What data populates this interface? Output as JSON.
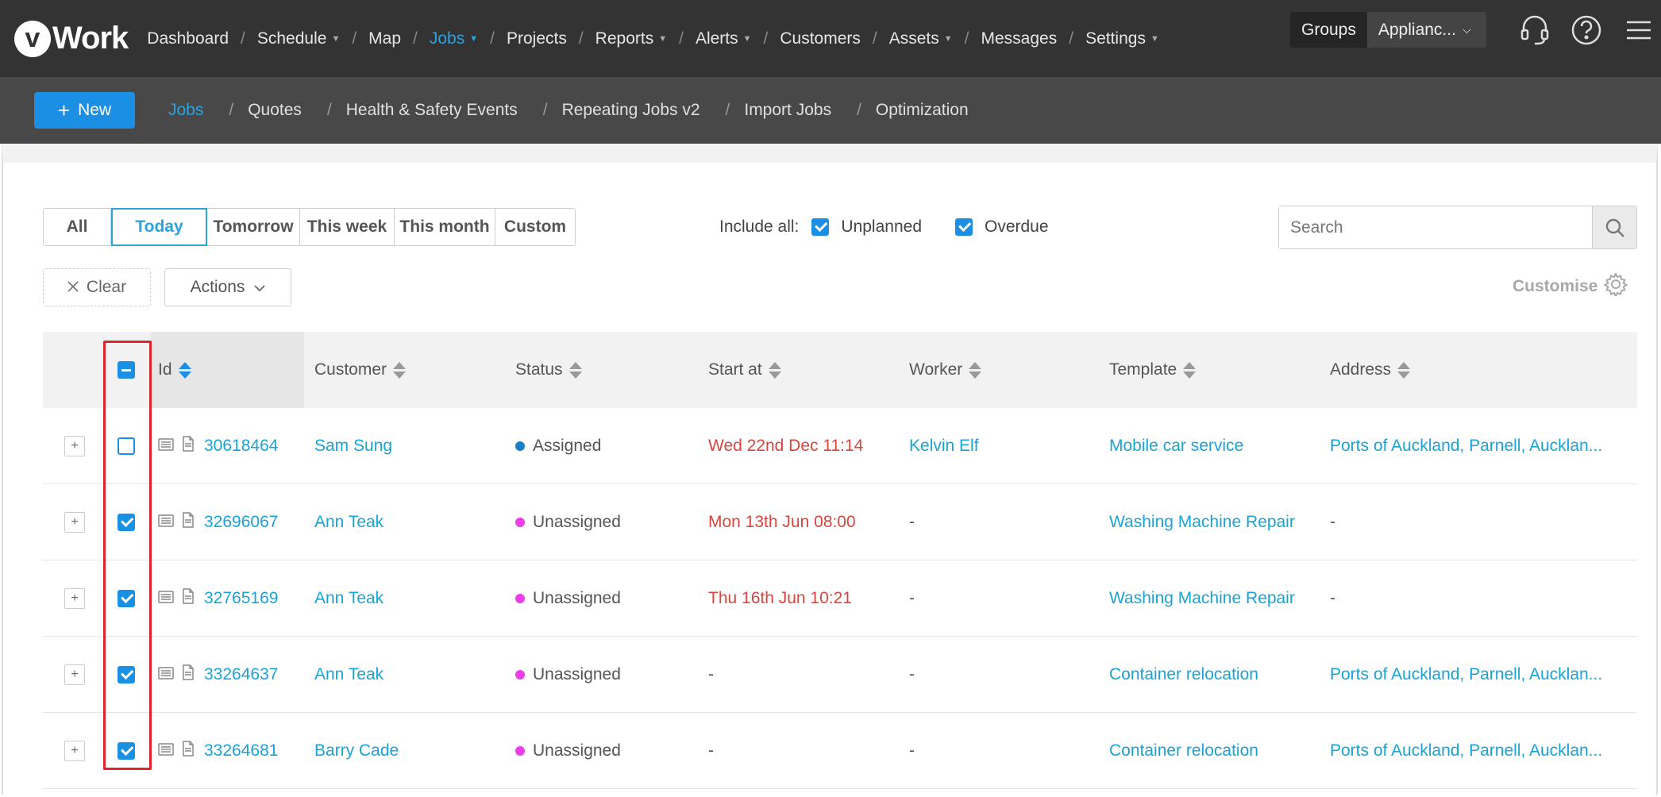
{
  "brand": {
    "logo_letter": "v",
    "logo_text": "Work"
  },
  "topnav": [
    {
      "label": "Dashboard",
      "caret": false,
      "active": false
    },
    {
      "label": "Schedule",
      "caret": true,
      "active": false
    },
    {
      "label": "Map",
      "caret": false,
      "active": false
    },
    {
      "label": "Jobs",
      "caret": true,
      "active": true
    },
    {
      "label": "Projects",
      "caret": false,
      "active": false
    },
    {
      "label": "Reports",
      "caret": true,
      "active": false
    },
    {
      "label": "Alerts",
      "caret": true,
      "active": false
    },
    {
      "label": "Customers",
      "caret": false,
      "active": false
    },
    {
      "label": "Assets",
      "caret": true,
      "active": false
    },
    {
      "label": "Messages",
      "caret": false,
      "active": false
    },
    {
      "label": "Settings",
      "caret": true,
      "active": false
    }
  ],
  "groups": {
    "label": "Groups",
    "value": "Applianc..."
  },
  "top_icons": [
    "headset-icon",
    "help-icon",
    "menu-icon"
  ],
  "subbar": {
    "new_label": "New",
    "items": [
      {
        "label": "Jobs",
        "active": true
      },
      {
        "label": "Quotes",
        "active": false
      },
      {
        "label": "Health & Safety Events",
        "active": false
      },
      {
        "label": "Repeating Jobs v2",
        "active": false
      },
      {
        "label": "Import Jobs",
        "active": false
      },
      {
        "label": "Optimization",
        "active": false
      }
    ]
  },
  "filters": {
    "ranges": [
      {
        "label": "All",
        "active": false
      },
      {
        "label": "Today",
        "active": true
      },
      {
        "label": "Tomorrow",
        "active": false
      },
      {
        "label": "This week",
        "active": false
      },
      {
        "label": "This month",
        "active": false
      },
      {
        "label": "Custom",
        "active": false
      }
    ],
    "include_label": "Include all:",
    "unplanned_label": "Unplanned",
    "unplanned_checked": true,
    "overdue_label": "Overdue",
    "overdue_checked": true,
    "search_placeholder": "Search",
    "search_value": ""
  },
  "toolbar": {
    "clear_label": "Clear",
    "actions_label": "Actions",
    "customise_label": "Customise"
  },
  "table": {
    "columns": [
      "Id",
      "Customer",
      "Status",
      "Start at",
      "Worker",
      "Template",
      "Address"
    ],
    "select_all_state": "partial",
    "rows": [
      {
        "checked": false,
        "id": "30618464",
        "customer": "Sam Sung",
        "status": "Assigned",
        "status_color": "#1a7fc4",
        "start": "Wed 22nd Dec 11:14",
        "start_overdue": true,
        "worker": "Kelvin Elf",
        "worker_link": true,
        "template": "Mobile car service",
        "address": "Ports of Auckland, Parnell, Aucklan...",
        "address_link": true
      },
      {
        "checked": true,
        "id": "32696067",
        "customer": "Ann Teak",
        "status": "Unassigned",
        "status_color": "#ee3ee8",
        "start": "Mon 13th Jun 08:00",
        "start_overdue": true,
        "worker": "-",
        "worker_link": false,
        "template": "Washing Machine Repair",
        "address": "-",
        "address_link": false
      },
      {
        "checked": true,
        "id": "32765169",
        "customer": "Ann Teak",
        "status": "Unassigned",
        "status_color": "#ee3ee8",
        "start": "Thu 16th Jun 10:21",
        "start_overdue": true,
        "worker": "-",
        "worker_link": false,
        "template": "Washing Machine Repair",
        "address": "-",
        "address_link": false
      },
      {
        "checked": true,
        "id": "33264637",
        "customer": "Ann Teak",
        "status": "Unassigned",
        "status_color": "#ee3ee8",
        "start": "-",
        "start_overdue": false,
        "worker": "-",
        "worker_link": false,
        "template": "Container relocation",
        "address": "Ports of Auckland, Parnell, Aucklan...",
        "address_link": true
      },
      {
        "checked": true,
        "id": "33264681",
        "customer": "Barry Cade",
        "status": "Unassigned",
        "status_color": "#ee3ee8",
        "start": "-",
        "start_overdue": false,
        "worker": "-",
        "worker_link": false,
        "template": "Container relocation",
        "address": "Ports of Auckland, Parnell, Aucklan...",
        "address_link": true
      }
    ]
  },
  "colors": {
    "accent": "#1a8fe3",
    "link": "#1aa3d8",
    "overdue": "#d9463d",
    "highlight": "#e0242e"
  }
}
